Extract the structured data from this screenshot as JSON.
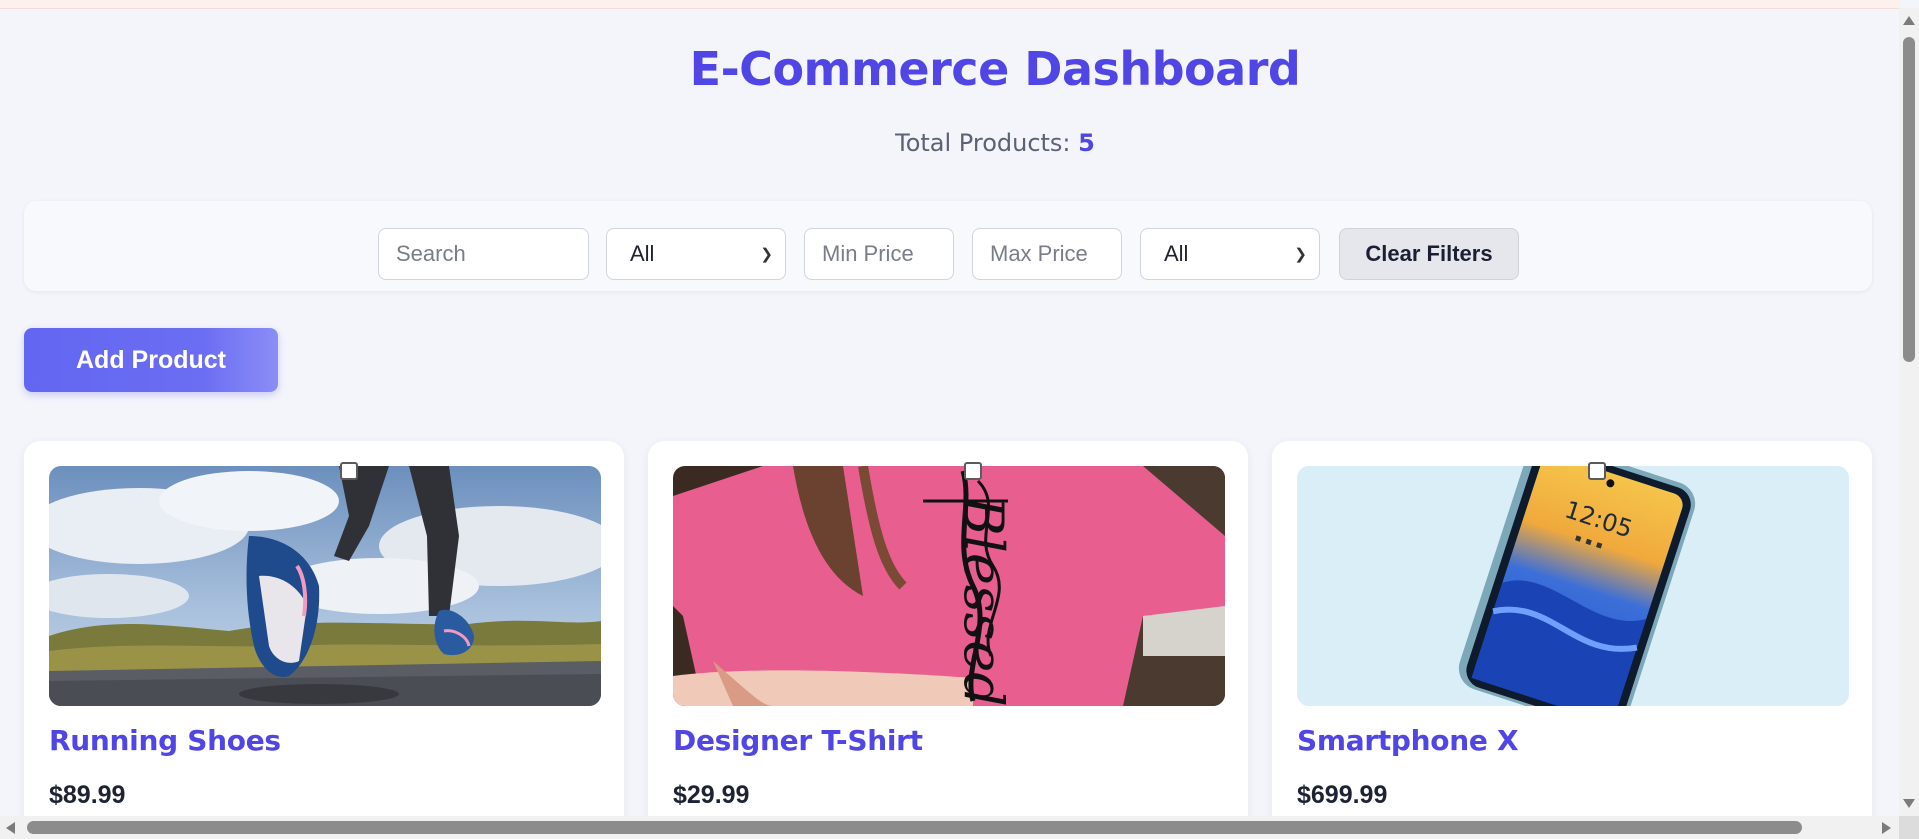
{
  "header": {
    "title": "E-Commerce Dashboard",
    "total_label": "Total Products:",
    "total_count": "5"
  },
  "filters": {
    "search_placeholder": "Search",
    "category_selected": "All",
    "min_price_placeholder": "Min Price",
    "max_price_placeholder": "Max Price",
    "status_selected": "All",
    "clear_label": "Clear Filters"
  },
  "actions": {
    "add_product_label": "Add Product"
  },
  "products": [
    {
      "name": "Running Shoes",
      "price": "$89.99",
      "image_icon": "running-shoes-photo"
    },
    {
      "name": "Designer T-Shirt",
      "price": "$29.99",
      "image_icon": "pink-tshirt-photo",
      "print_text": "Blessed"
    },
    {
      "name": "Smartphone X",
      "price": "$699.99",
      "image_icon": "smartphone-photo",
      "screen_time": "12:05"
    }
  ],
  "colors": {
    "accent": "#4f46e5",
    "button": "#6366f1",
    "background": "#f4f5fb"
  }
}
